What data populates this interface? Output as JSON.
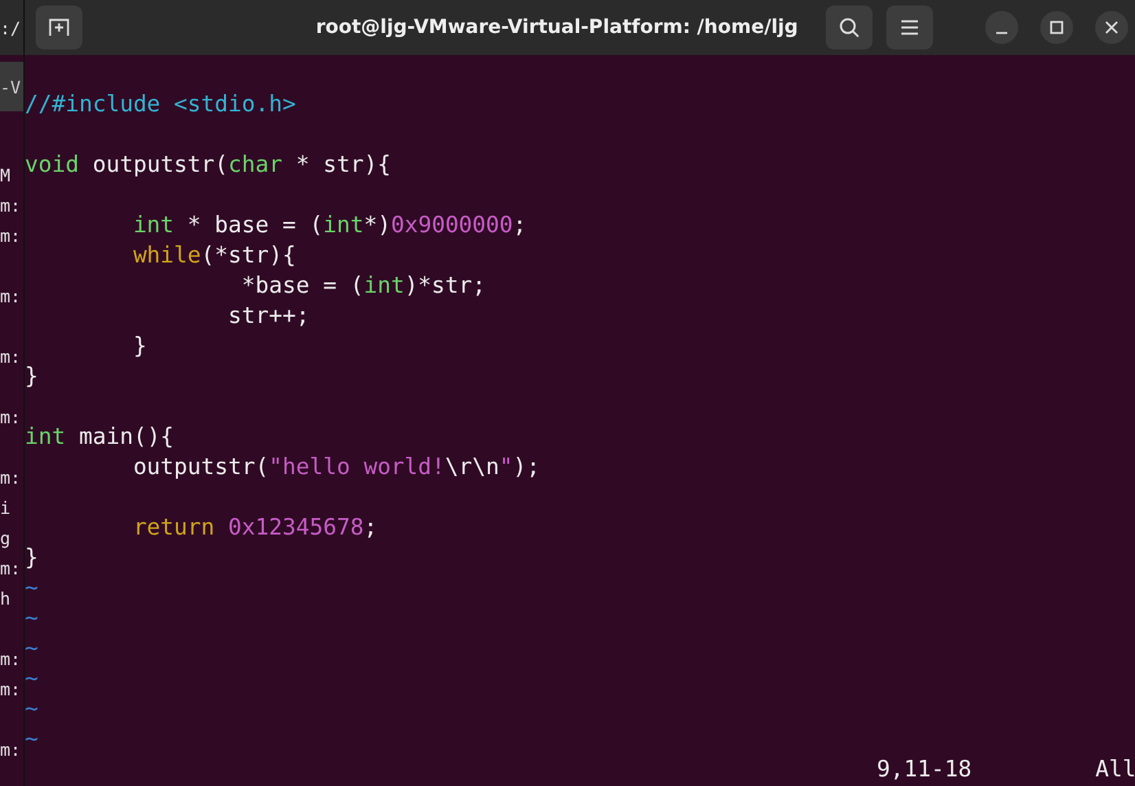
{
  "background_window": {
    "title": ":/",
    "tab": "-V",
    "lines": [
      {
        "kind": "text",
        "text": "M"
      },
      {
        "kind": "text",
        "text": "m:"
      },
      {
        "kind": "text",
        "text": "m:"
      },
      {
        "kind": "blank"
      },
      {
        "kind": "text",
        "text": "m:"
      },
      {
        "kind": "blank"
      },
      {
        "kind": "text",
        "text": "m:"
      },
      {
        "kind": "blank"
      },
      {
        "kind": "text",
        "text": "m:"
      },
      {
        "kind": "blank"
      },
      {
        "kind": "text",
        "text": "m:"
      },
      {
        "kind": "text",
        "text": "i"
      },
      {
        "kind": "text",
        "text": "g"
      },
      {
        "kind": "text",
        "text": "m:"
      },
      {
        "kind": "text",
        "text": "h"
      },
      {
        "kind": "blank"
      },
      {
        "kind": "text",
        "text": "m:"
      },
      {
        "kind": "text",
        "text": "m:"
      },
      {
        "kind": "blank"
      },
      {
        "kind": "text",
        "text": "m:"
      }
    ]
  },
  "window": {
    "title": "root@ljg-VMware-Virtual-Platform: /home/ljg"
  },
  "editor": {
    "lines": [
      {
        "kind": "code",
        "tokens": [
          {
            "kind": "comment",
            "text": "//#include <stdio.h>"
          }
        ]
      },
      {
        "kind": "blank"
      },
      {
        "kind": "code",
        "tokens": [
          {
            "kind": "type",
            "text": "void"
          },
          {
            "kind": "plain",
            "text": " outputstr("
          },
          {
            "kind": "type",
            "text": "char"
          },
          {
            "kind": "plain",
            "text": " * str){"
          }
        ]
      },
      {
        "kind": "blank"
      },
      {
        "kind": "code",
        "indented": true,
        "tokens": [
          {
            "kind": "type",
            "text": "int"
          },
          {
            "kind": "plain",
            "text": " * base = ("
          },
          {
            "kind": "type",
            "text": "int"
          },
          {
            "kind": "plain",
            "text": "*)"
          },
          {
            "kind": "number",
            "text": "0x9000000"
          },
          {
            "kind": "plain",
            "text": ";"
          }
        ]
      },
      {
        "kind": "code",
        "indented": true,
        "tokens": [
          {
            "kind": "keyword",
            "text": "while"
          },
          {
            "kind": "plain",
            "text": "(*str){"
          }
        ]
      },
      {
        "kind": "code",
        "tokens": [
          {
            "kind": "plain",
            "text": "                *base = ("
          },
          {
            "kind": "type",
            "text": "int"
          },
          {
            "kind": "plain",
            "text": ")*str;"
          }
        ]
      },
      {
        "kind": "code",
        "tokens": [
          {
            "kind": "plain",
            "text": "               str++;"
          }
        ]
      },
      {
        "kind": "code",
        "tokens": [
          {
            "kind": "plain",
            "text": "        }"
          }
        ]
      },
      {
        "kind": "code",
        "tokens": [
          {
            "kind": "plain",
            "text": "}"
          }
        ]
      },
      {
        "kind": "blank"
      },
      {
        "kind": "code",
        "tokens": [
          {
            "kind": "type",
            "text": "int"
          },
          {
            "kind": "plain",
            "text": " main(){"
          }
        ]
      },
      {
        "kind": "code",
        "tokens": [
          {
            "kind": "plain",
            "text": "        outputstr("
          },
          {
            "kind": "string",
            "text": "\"hello world!"
          },
          {
            "kind": "plain",
            "text": "\\r\\n"
          },
          {
            "kind": "string",
            "text": "\""
          },
          {
            "kind": "plain",
            "text": ");"
          }
        ]
      },
      {
        "kind": "blank"
      },
      {
        "kind": "code",
        "indented": true,
        "tokens": [
          {
            "kind": "keyword",
            "text": "return"
          },
          {
            "kind": "number",
            "text": " 0x12345678"
          },
          {
            "kind": "plain",
            "text": ";"
          }
        ]
      },
      {
        "kind": "code",
        "tokens": [
          {
            "kind": "plain",
            "text": "}"
          }
        ]
      },
      {
        "kind": "filler",
        "text": "~"
      },
      {
        "kind": "filler",
        "text": "~"
      },
      {
        "kind": "filler",
        "text": "~"
      },
      {
        "kind": "filler",
        "text": "~"
      },
      {
        "kind": "filler",
        "text": "~"
      },
      {
        "kind": "filler",
        "text": "~"
      }
    ],
    "status": {
      "position": "9,11-18",
      "scroll": "All"
    }
  }
}
